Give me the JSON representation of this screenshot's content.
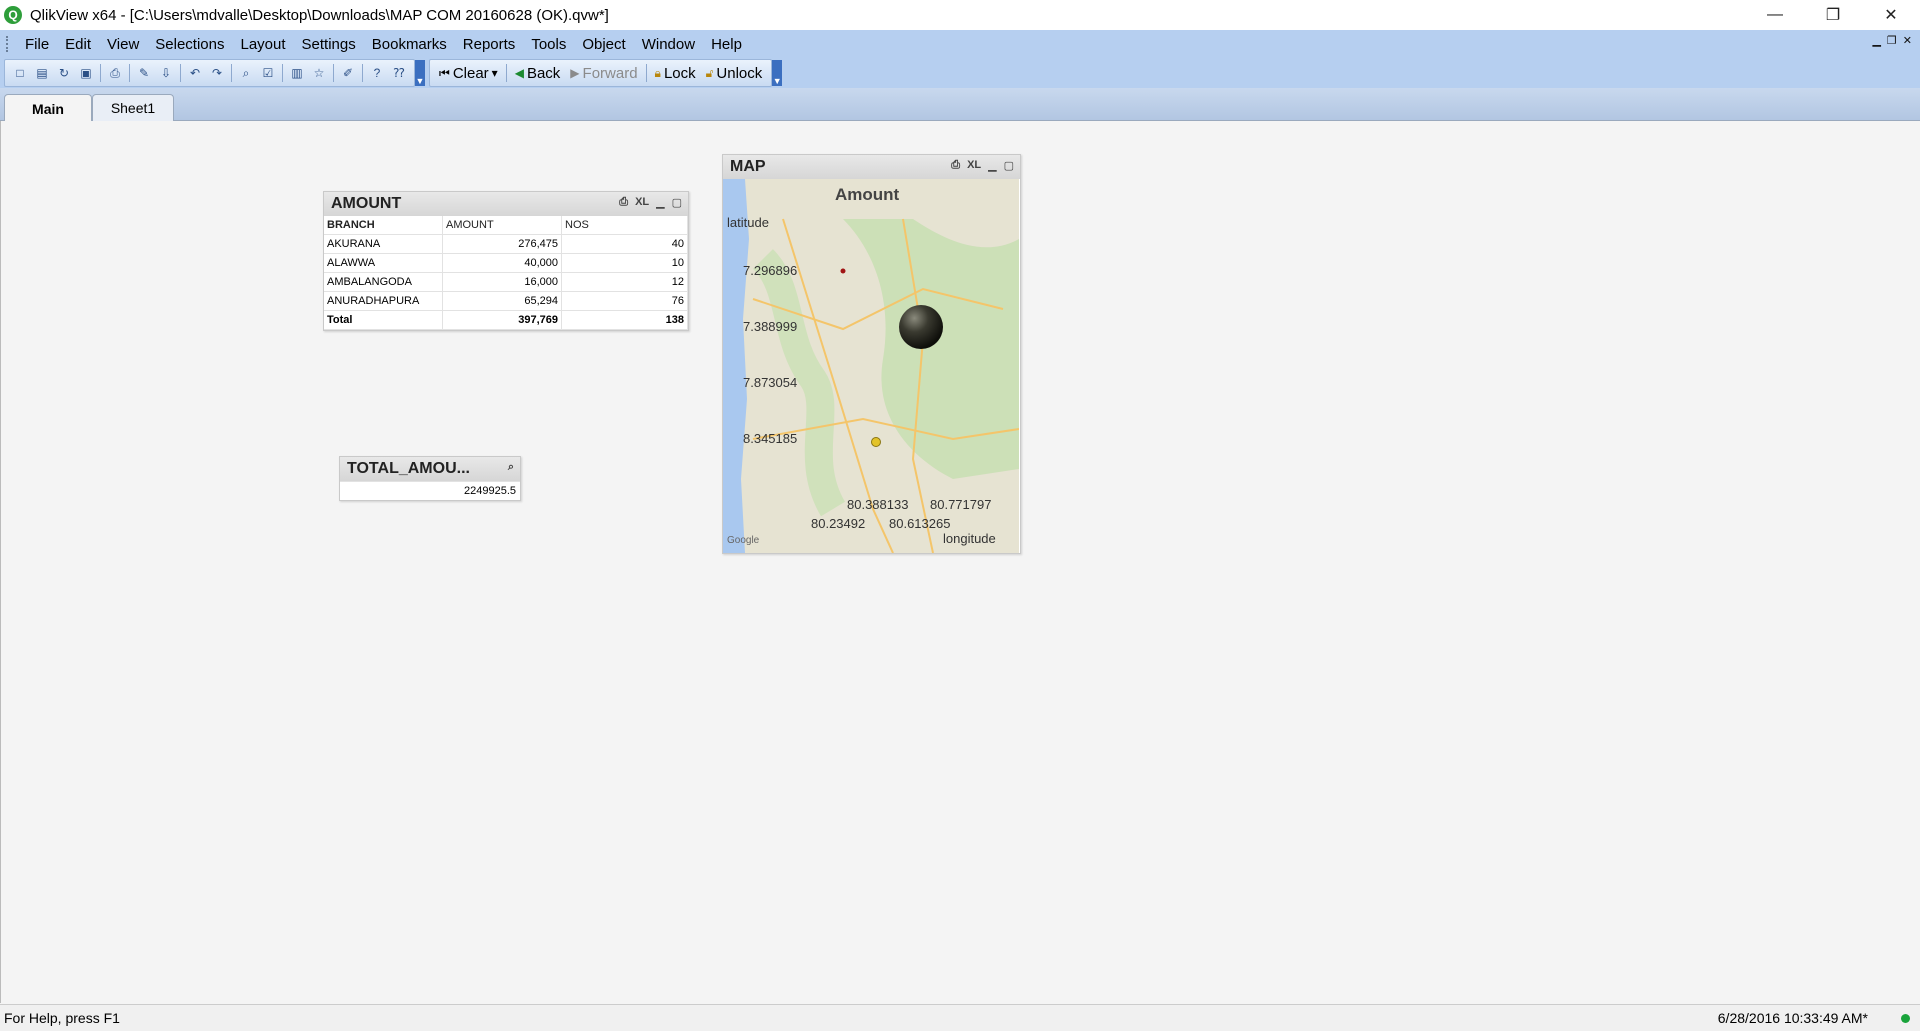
{
  "window": {
    "title": "QlikView x64 - [C:\\Users\\mdvalle\\Desktop\\Downloads\\MAP COM 20160628 (OK).qvw*]",
    "app_icon_letter": "Q",
    "minimize": "—",
    "restore": "❐",
    "close": "✕"
  },
  "menu": {
    "items": [
      "File",
      "Edit",
      "View",
      "Selections",
      "Layout",
      "Settings",
      "Bookmarks",
      "Reports",
      "Tools",
      "Object",
      "Window",
      "Help"
    ]
  },
  "toolbar": {
    "clear_label": "Clear",
    "back_label": "Back",
    "forward_label": "Forward",
    "lock_label": "Lock",
    "unlock_label": "Unlock"
  },
  "tabs": {
    "main": "Main",
    "sheet1": "Sheet1"
  },
  "amount_table": {
    "title": "AMOUNT",
    "xl_label": "XL",
    "columns": [
      "BRANCH",
      "AMOUNT",
      "NOS"
    ],
    "rows": [
      [
        "AKURANA",
        "276,475",
        "40"
      ],
      [
        "ALAWWA",
        "40,000",
        "10"
      ],
      [
        "AMBALANGODA",
        "16,000",
        "12"
      ],
      [
        "ANURADHAPURA",
        "65,294",
        "76"
      ]
    ],
    "total": [
      "Total",
      "397,769",
      "138"
    ]
  },
  "total_amount": {
    "title": "TOTAL_AMOU...",
    "value": "2249925.5"
  },
  "map": {
    "title": "MAP",
    "xl_label": "XL",
    "chart_title": "Amount",
    "y_label": "latitude",
    "x_label": "longitude",
    "lat_ticks": [
      "7.296896",
      "7.388999",
      "7.873054",
      "8.345185"
    ],
    "lon_ticks": [
      "80.388133",
      "80.771797",
      "80.23492",
      "80.613265"
    ],
    "google_label": "Google"
  },
  "status": {
    "left": "For Help, press F1",
    "right": "6/28/2016 10:33:49 AM*"
  }
}
